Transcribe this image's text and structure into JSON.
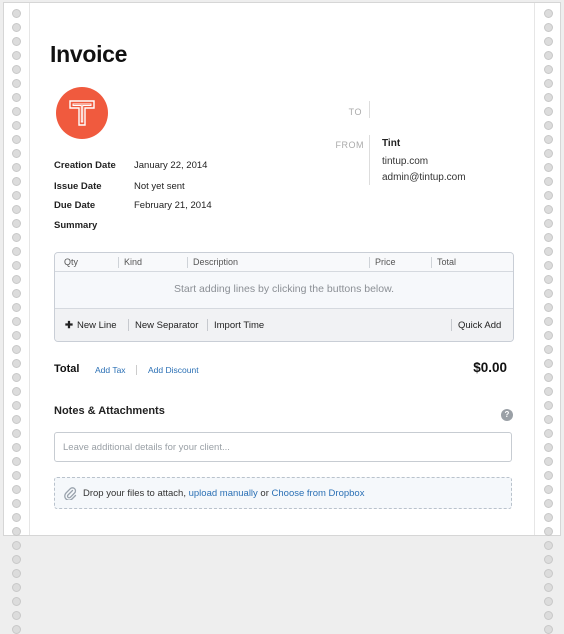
{
  "invoice": {
    "title": "Invoice"
  },
  "parties": {
    "to_label": "TO",
    "from_label": "FROM",
    "from_name": "Tint",
    "from_lines": [
      "tintup.com",
      "admin@tintup.com"
    ]
  },
  "meta": [
    {
      "label": "Creation Date",
      "value": "January 22, 2014"
    },
    {
      "label": "Issue Date",
      "value": "Not yet sent"
    },
    {
      "label": "Due Date",
      "value": "February 21, 2014"
    },
    {
      "label": "Summary",
      "value": ""
    }
  ],
  "table": {
    "columns": [
      "Qty",
      "Kind",
      "Description",
      "Price",
      "Total"
    ],
    "empty_message": "Start adding lines by clicking the buttons below.",
    "actions": {
      "new_line": "New Line",
      "new_separator": "New Separator",
      "import_time": "Import Time",
      "quick_add": "Quick Add"
    }
  },
  "totals": {
    "label": "Total",
    "add_tax": "Add Tax",
    "add_discount": "Add Discount",
    "amount": "$0.00"
  },
  "notes": {
    "title": "Notes & Attachments",
    "help": "?",
    "placeholder": "Leave additional details for your client...",
    "drop_prefix": "Drop your files to attach, ",
    "upload_link": "upload manually",
    "or_text": " or ",
    "dropbox_link": "Choose from Dropbox"
  },
  "colors": {
    "logo": "#f05a3e",
    "link": "#2b70b5"
  },
  "icons": {
    "logo": "t-logo-icon",
    "add": "plus-icon",
    "help": "help-icon",
    "attach": "paperclip-icon"
  }
}
